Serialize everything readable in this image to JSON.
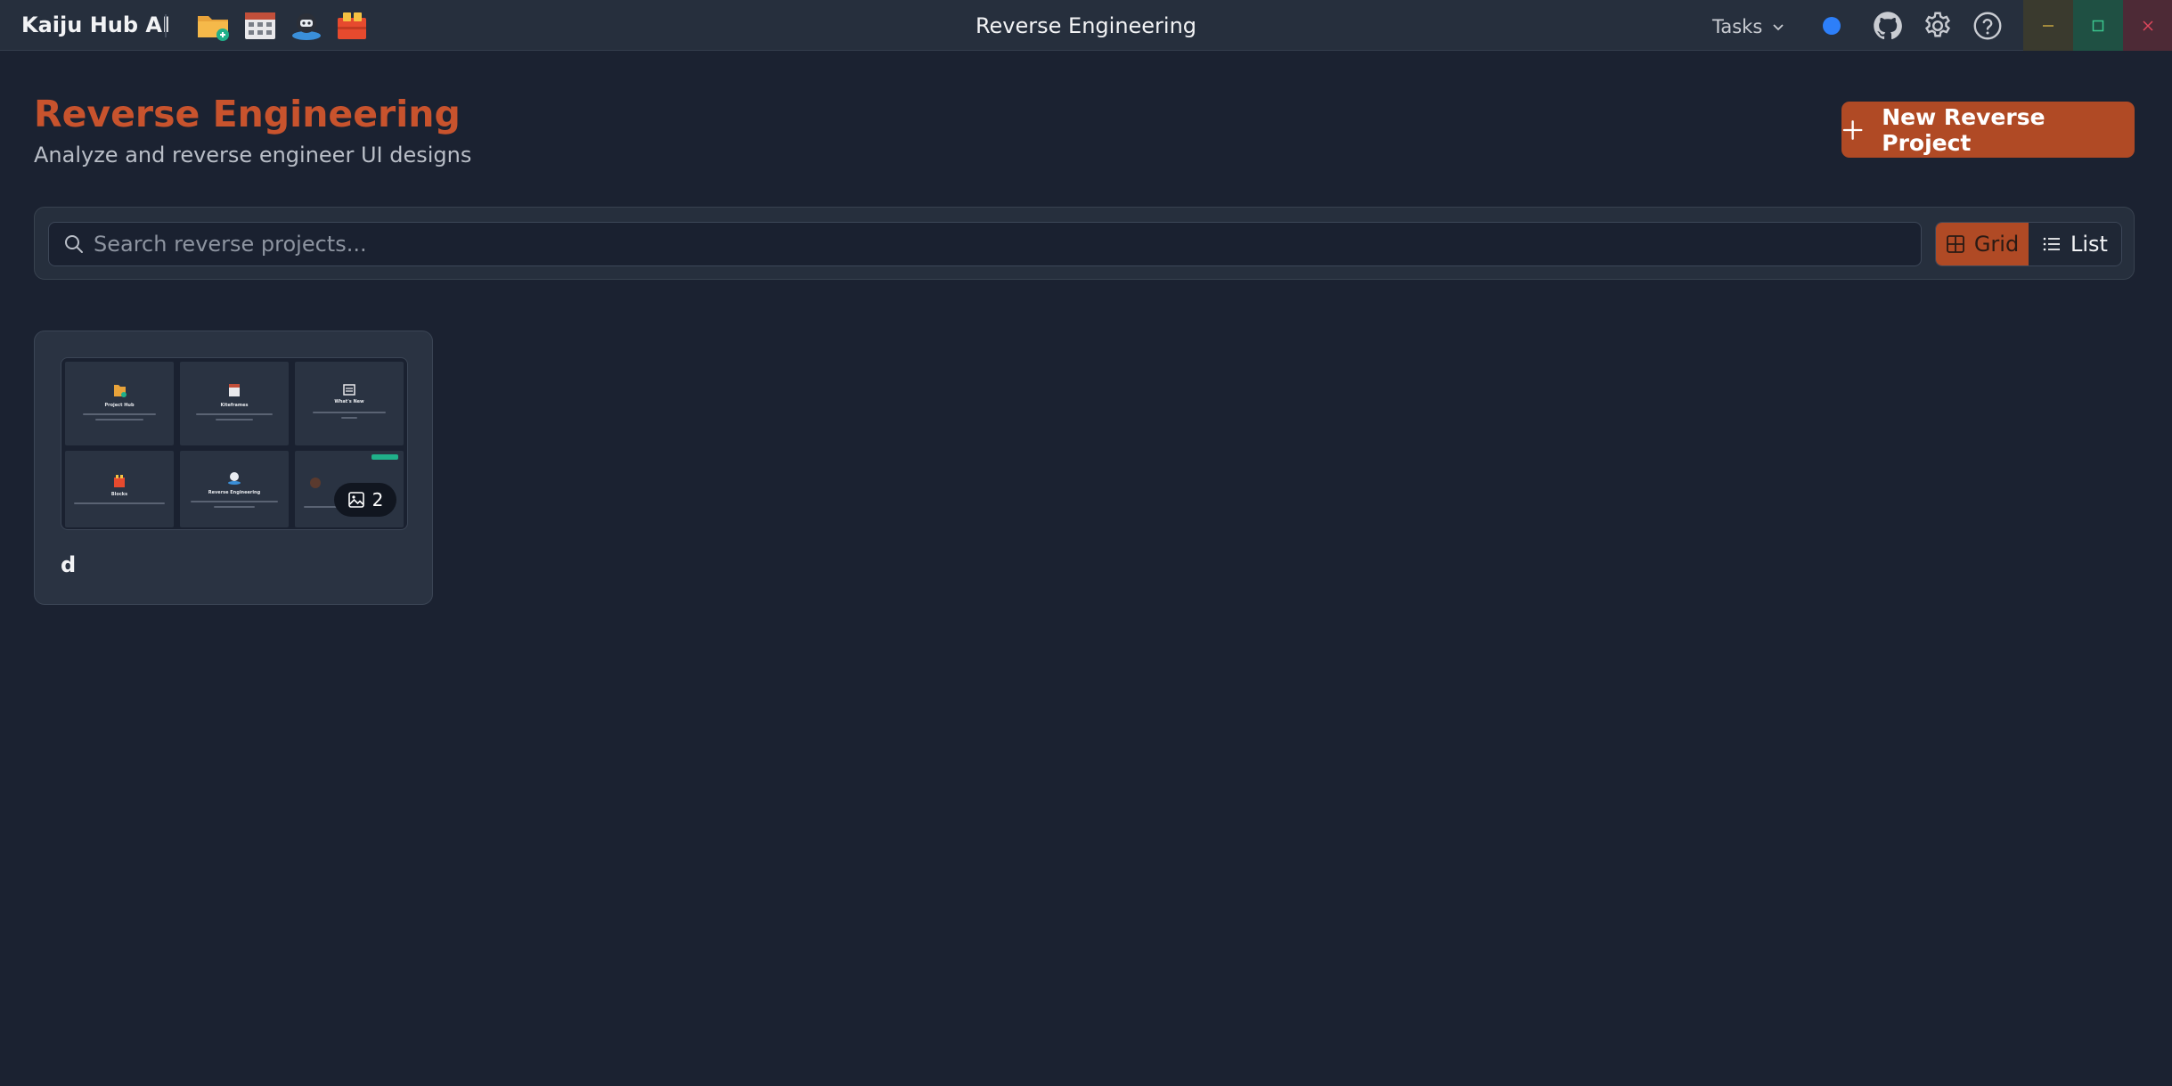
{
  "titlebar": {
    "app_name": "Kaiju Hub AI",
    "window_title": "Reverse Engineering",
    "tasks_label": "Tasks",
    "quick_apps": [
      "folder-app-icon",
      "calendar-app-icon",
      "reverse-engineering-app-icon",
      "blocks-app-icon"
    ],
    "status_color": "#2d7ff9",
    "window_controls": [
      "minimize",
      "maximize",
      "close"
    ]
  },
  "header": {
    "title": "Reverse Engineering",
    "subtitle": "Analyze and reverse engineer UI designs",
    "new_button_label": "New Reverse Project"
  },
  "search": {
    "placeholder": "Search reverse projects...",
    "value": ""
  },
  "view_toggle": {
    "grid_label": "Grid",
    "list_label": "List",
    "selected": "Grid"
  },
  "projects": [
    {
      "name": "d",
      "image_count": "2",
      "thumbnail_tiles": [
        {
          "title": "Project Hub",
          "icon": "folder-icon"
        },
        {
          "title": "Kiteframes",
          "icon": "calendar-icon"
        },
        {
          "title": "What's New",
          "icon": "news-icon"
        },
        {
          "title": "Blocks",
          "icon": "blocks-icon"
        },
        {
          "title": "Reverse Engineering",
          "icon": "robot-icon"
        },
        {
          "title": "",
          "icon": "avatar-icon"
        }
      ]
    }
  ],
  "colors": {
    "accent": "#b04a25",
    "title": "#c8532d",
    "background": "#1b2231",
    "surface": "#262f3d"
  }
}
